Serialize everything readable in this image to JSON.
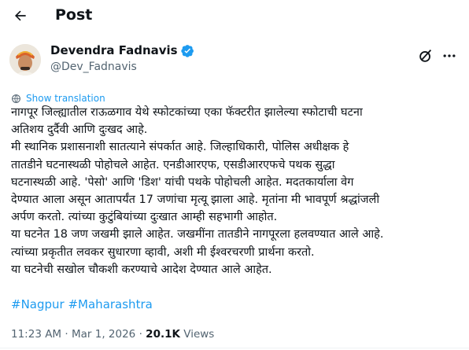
{
  "header": {
    "title": "Post"
  },
  "author": {
    "name": "Devendra Fadnavis",
    "handle": "@Dev_Fadnavis"
  },
  "translate_label": "Show translation",
  "post_lines": [
    "नागपूर जिल्ह्यातील राऊळगाव येथे स्फोटकांच्या एका फॅक्टरीत झालेल्या स्फोटाची घटना",
    "अतिशय दुर्दैवी आणि दुःखद आहे.",
    "मी स्थानिक प्रशासनाशी सातत्याने संपर्कात आहे. जिल्हाधिकारी, पोलिस अधीक्षक हे",
    "तातडीने घटनास्थळी पोहोचले आहेत. एनडीआरएफ, एसडीआरएफचे पथक सुद्धा",
    "घटनास्थळी आहे. 'पेसो' आणि 'डिश' यांची पथके पोहोचली आहेत. मदतकार्याला वेग",
    "देण्यात आला असून आतापर्यंत 17 जणांचा मृत्यू झाला आहे. मृतांना मी भावपूर्ण श्रद्धांजली",
    "अर्पण करतो. त्यांच्या कुटुंबियांच्या दुःखात आम्ही सहभागी आहोत.",
    "या घटनेत 18 जण जखमी झाले आहेत. जखमींना तातडीने नागपूरला हलवण्यात आले आहे.",
    "त्यांच्या प्रकृतीत लवकर सुधारणा व्हावी, अशी मी ईश्वरचरणी प्रार्थना करतो.",
    "या घटनेची सखोल चौकशी करण्याचे आदेश देण्यात आले आहेत."
  ],
  "hashtags": [
    "#Nagpur",
    "#Maharashtra"
  ],
  "meta": {
    "time": "11:23 AM",
    "sep": "·",
    "date": "Mar 1, 2026",
    "views_count": "20.1K",
    "views_label": "Views"
  },
  "colors": {
    "link": "#1d9bf0",
    "muted": "#536471",
    "text": "#0f1419"
  },
  "icons": {
    "back": "arrow-left-icon",
    "verified": "verified-badge-icon",
    "grok": "grok-icon",
    "more": "more-icon",
    "translate": "globe-icon"
  }
}
